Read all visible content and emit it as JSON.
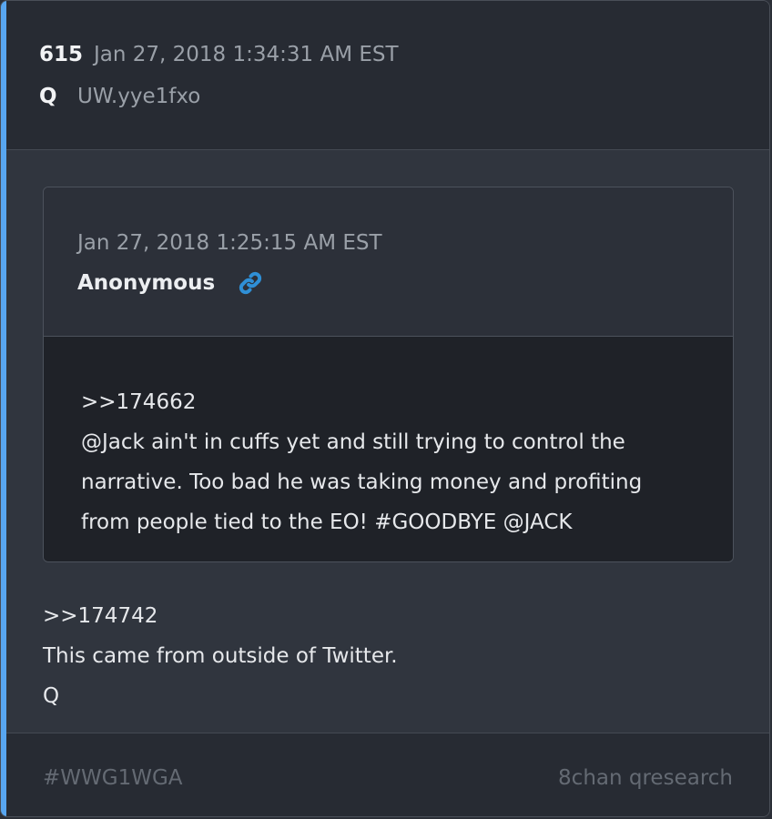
{
  "post": {
    "number": "615",
    "date": "Jan 27, 2018 1:34:31 AM EST",
    "author": "Q",
    "tripcode": "UW.yye1fxo"
  },
  "quoted_post": {
    "date": "Jan 27, 2018 1:25:15 AM EST",
    "author": "Anonymous",
    "link_icon": "link-icon",
    "lines": [
      ">>174662",
      "@Jack ain't in cuffs yet and still trying to control the",
      "narrative. Too bad he was taking money and profiting",
      "from people tied to the EO! #GOODBYE @JACK"
    ]
  },
  "message": {
    "lines": [
      ">>174742",
      "This came from outside of Twitter.",
      "Q"
    ]
  },
  "footer": {
    "hashtag": "#WWG1WGA",
    "source": "8chan qresearch"
  },
  "colors": {
    "accent": "#58a6f0",
    "link": "#2f8fd6"
  }
}
